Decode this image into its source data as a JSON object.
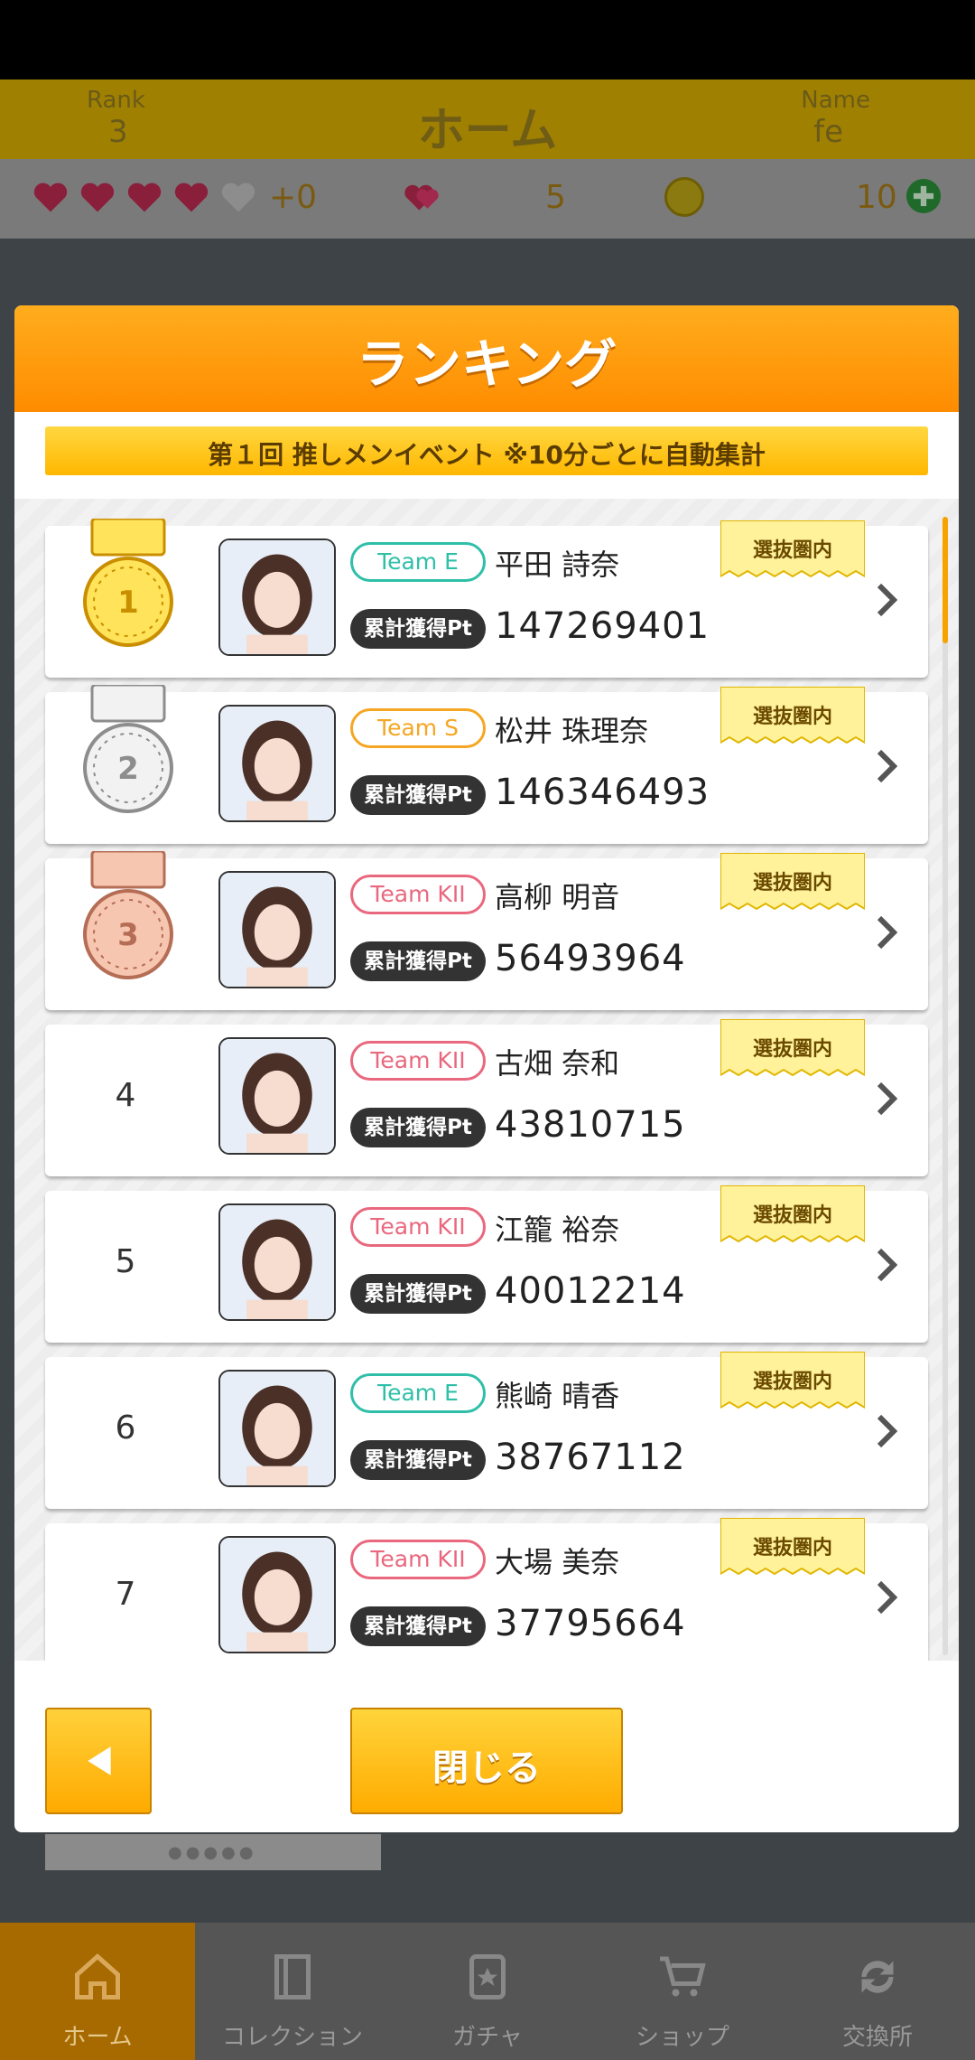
{
  "header": {
    "rank_label": "Rank",
    "rank_value": "3",
    "title": "ホーム",
    "name_label": "Name",
    "name_value": "fe"
  },
  "resources": {
    "hearts_filled": 4,
    "hearts_total": 5,
    "hearts_extra": "+0",
    "gem_count": "5",
    "coin_count": "10"
  },
  "modal": {
    "title": "ランキング",
    "event_banner": "第１回 推しメンイベント ※10分ごとに自動集計",
    "close_label": "閉じる",
    "pt_label": "累計獲得Pt",
    "select_badge": "選抜圏内"
  },
  "ranking": [
    {
      "rank": "1",
      "team": "Team E",
      "team_color": "#2fbfa8",
      "name": "平田 詩奈",
      "points": "147269401",
      "medal": "gold"
    },
    {
      "rank": "2",
      "team": "Team S",
      "team_color": "#f5a623",
      "name": "松井 珠理奈",
      "points": "146346493",
      "medal": "silver"
    },
    {
      "rank": "3",
      "team": "Team KII",
      "team_color": "#e9687e",
      "name": "高柳 明音",
      "points": "56493964",
      "medal": "bronze"
    },
    {
      "rank": "4",
      "team": "Team KII",
      "team_color": "#e9687e",
      "name": "古畑 奈和",
      "points": "43810715",
      "medal": ""
    },
    {
      "rank": "5",
      "team": "Team KII",
      "team_color": "#e9687e",
      "name": "江籠 裕奈",
      "points": "40012214",
      "medal": ""
    },
    {
      "rank": "6",
      "team": "Team E",
      "team_color": "#2fbfa8",
      "name": "熊崎 晴香",
      "points": "38767112",
      "medal": ""
    },
    {
      "rank": "7",
      "team": "Team KII",
      "team_color": "#e9687e",
      "name": "大場 美奈",
      "points": "37795664",
      "medal": ""
    }
  ],
  "bottom_nav": [
    {
      "label": "ホーム",
      "icon": "home-icon",
      "active": true
    },
    {
      "label": "コレクション",
      "icon": "book-icon",
      "active": false
    },
    {
      "label": "ガチャ",
      "icon": "card-star-icon",
      "active": false
    },
    {
      "label": "ショップ",
      "icon": "cart-icon",
      "active": false
    },
    {
      "label": "交換所",
      "icon": "exchange-icon",
      "active": false
    }
  ],
  "colors": {
    "accent": "#ff9f0f",
    "banner": "#ffc21f",
    "nav_active": "#a66a00"
  }
}
